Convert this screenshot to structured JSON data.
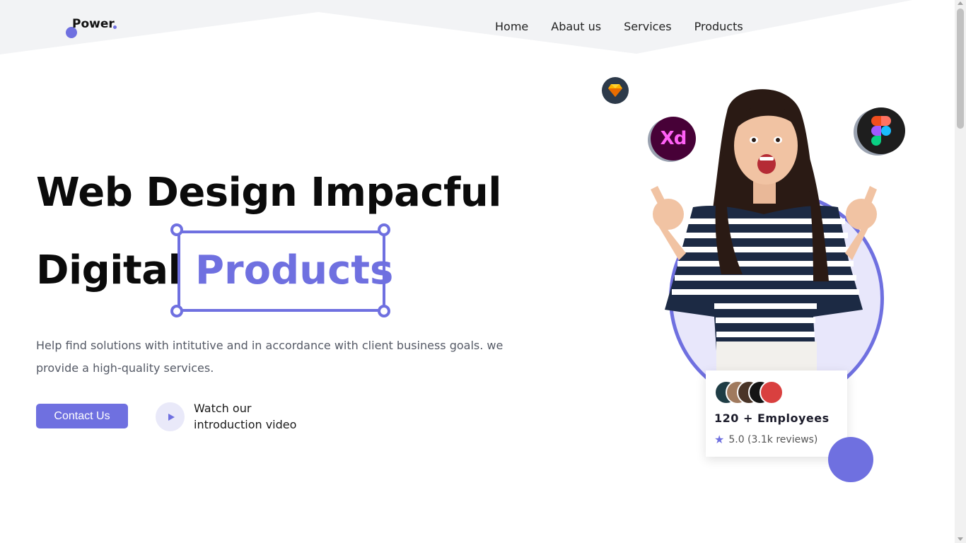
{
  "brand": {
    "name": "Power",
    "accent_color": "#6f70e0"
  },
  "nav": {
    "items": [
      {
        "label": "Home"
      },
      {
        "label": "Abaut us"
      },
      {
        "label": "Services"
      },
      {
        "label": "Products"
      }
    ]
  },
  "hero": {
    "line1": "Web Design Impacful",
    "line2_prefix": "Digital",
    "highlight_word": "Products",
    "description": "Help find solutions with intitutive and in accordance with client business goals. we provide a high-quality services.",
    "cta_label": "Contact Us",
    "video_label_line1": "Watch our",
    "video_label_line2": "introduction video"
  },
  "illustration": {
    "tool_icons": [
      "sketch-icon",
      "adobe-xd-icon",
      "figma-icon"
    ],
    "xd_label": "Xd"
  },
  "stats_card": {
    "title": "120 + Employees",
    "rating": "5.0 (3.1k reviews)"
  }
}
